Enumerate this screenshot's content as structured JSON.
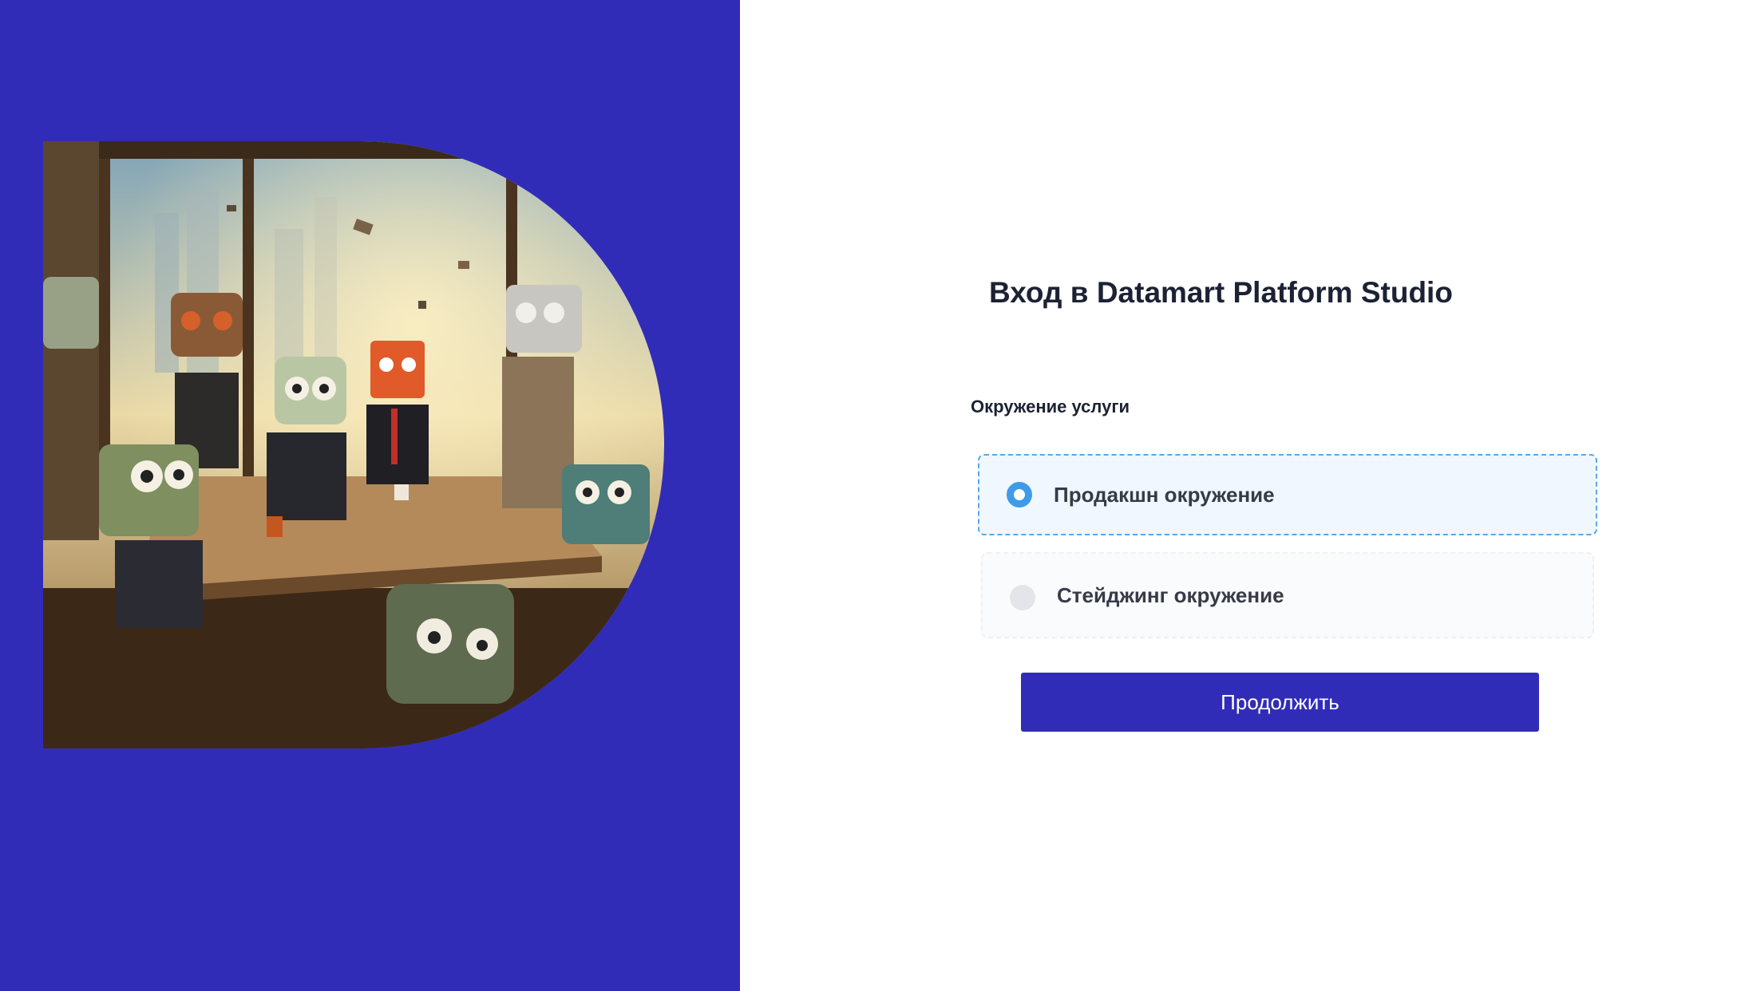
{
  "colors": {
    "brand": "#312cb8",
    "accent": "#3f9be8",
    "title_text": "#1c2233",
    "selected_option_bg": "#f0f7ff"
  },
  "hero": {
    "description_icon": "illustration-robots-meeting"
  },
  "login": {
    "title": "Вход в Datamart Platform Studio",
    "environment_label": "Окружение услуги",
    "options": [
      {
        "label": "Продакшн окружение",
        "selected": true
      },
      {
        "label": "Стейджинг окружение",
        "selected": false
      }
    ],
    "continue_label": "Продолжить"
  }
}
